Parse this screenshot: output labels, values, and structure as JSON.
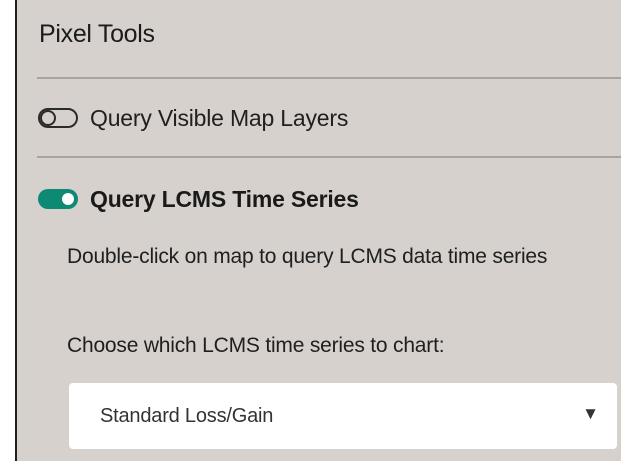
{
  "panel": {
    "title": "Pixel Tools",
    "tools": [
      {
        "label": "Query Visible Map Layers",
        "enabled": false,
        "icon": "toggle-off-icon"
      },
      {
        "label": "Query LCMS Time Series",
        "enabled": true,
        "icon": "toggle-on-icon",
        "accent_color": "#0e8a74",
        "description": "Double-click on map to query LCMS data time series",
        "choose_label": "Choose which LCMS time series to chart:",
        "select": {
          "value": "Standard Loss/Gain",
          "icon": "dropdown-arrow-icon",
          "arrow": "▼"
        }
      }
    ]
  }
}
